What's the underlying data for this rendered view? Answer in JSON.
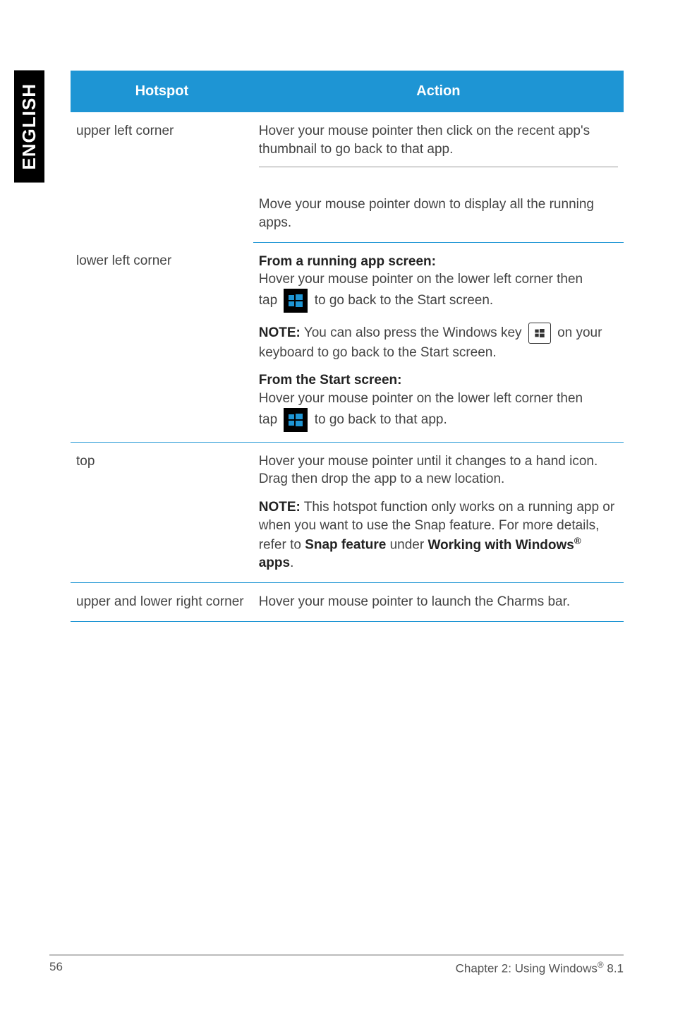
{
  "side_tab": "ENGLISH",
  "table": {
    "headers": {
      "hotspot": "Hotspot",
      "action": "Action"
    },
    "rows": {
      "upper_left": {
        "label": "upper left corner",
        "p1": "Hover your mouse pointer then click on the recent app's thumbnail to go back to that app.",
        "p2": "Move your mouse pointer down to display all the running apps."
      },
      "lower_left": {
        "label": "lower left corner",
        "running_heading": "From a running app screen:",
        "running_line1": "Hover your mouse pointer on the lower left corner then",
        "running_line2a": "tap ",
        "running_line2b": " to go back to the Start screen.",
        "note_prefix": "NOTE:",
        "note_texta": "  You can also press the Windows key ",
        "note_textb": " on your keyboard to go back to the Start screen.",
        "start_heading": "From the Start screen:",
        "start_line1": "Hover your mouse pointer on the lower left corner then",
        "start_line2a": "tap ",
        "start_line2b": " to go back to that app."
      },
      "top": {
        "label": "top",
        "p1": "Hover your mouse pointer until it changes to a hand icon. Drag then drop the app to a new location.",
        "note_prefix": "NOTE:",
        "note_text": "  This hotspot function only works on a running app or when you want to use the Snap feature. For more details, refer to ",
        "note_bold1": "Snap feature",
        "note_mid": " under ",
        "note_bold2": "Working with Windows",
        "reg": "®",
        "note_tail": " apps",
        "period": "."
      },
      "upper_lower_right": {
        "label": "upper and lower right corner",
        "p1": "Hover your mouse pointer to launch the Charms bar."
      }
    }
  },
  "footer": {
    "page": "56",
    "chapter_a": "Chapter 2: Using Windows",
    "reg": "®",
    "chapter_b": " 8.1"
  }
}
